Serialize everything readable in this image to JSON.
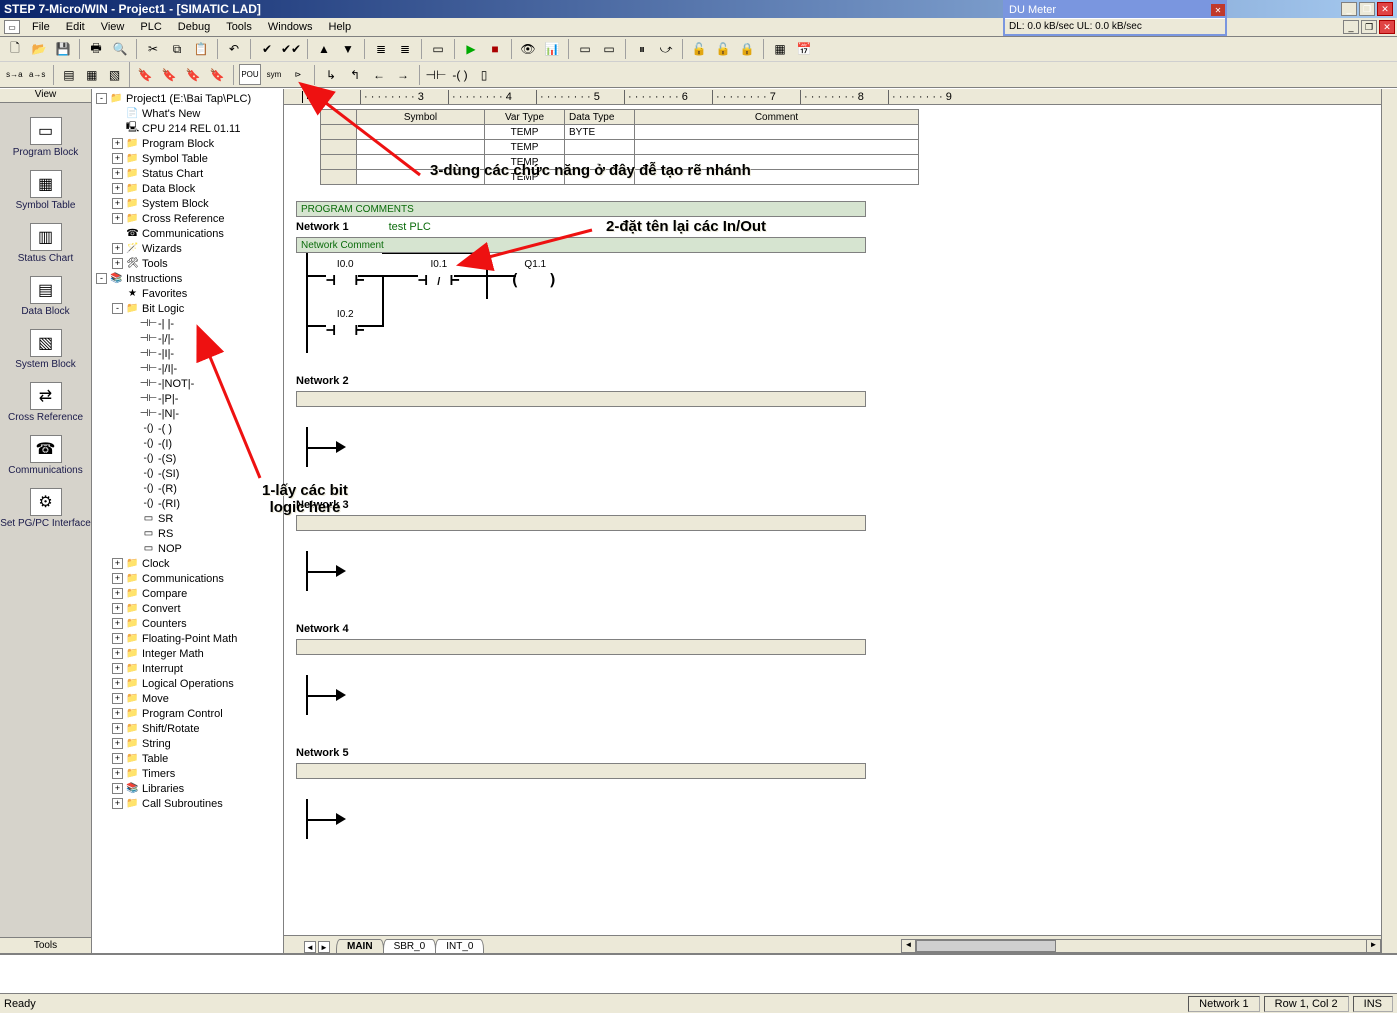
{
  "window": {
    "title": "STEP 7-Micro/WIN - Project1 - [SIMATIC LAD]"
  },
  "overlay": {
    "title": "DU Meter",
    "stats": "DL: 0.0 kB/sec   UL: 0.0 kB/sec"
  },
  "menus": [
    "File",
    "Edit",
    "View",
    "PLC",
    "Debug",
    "Tools",
    "Windows",
    "Help"
  ],
  "navpanel": {
    "header": "View",
    "items": [
      {
        "label": "Program Block",
        "icon": "▭"
      },
      {
        "label": "Symbol Table",
        "icon": "▦"
      },
      {
        "label": "Status Chart",
        "icon": "▥"
      },
      {
        "label": "Data Block",
        "icon": "▤"
      },
      {
        "label": "System Block",
        "icon": "▧"
      },
      {
        "label": "Cross Reference",
        "icon": "⇄"
      },
      {
        "label": "Communications",
        "icon": "☎"
      },
      {
        "label": "Set PG/PC Interface",
        "icon": "⚙"
      }
    ],
    "footer": "Tools"
  },
  "tree": [
    {
      "lvl": 0,
      "exp": "-",
      "icon": "📁",
      "label": "Project1 (E:\\Bai Tap\\PLC)"
    },
    {
      "lvl": 1,
      "exp": "",
      "icon": "📄",
      "label": "What's New"
    },
    {
      "lvl": 1,
      "exp": "",
      "icon": "🖳",
      "label": "CPU 214 REL 01.11"
    },
    {
      "lvl": 1,
      "exp": "+",
      "icon": "📁",
      "label": "Program Block"
    },
    {
      "lvl": 1,
      "exp": "+",
      "icon": "📁",
      "label": "Symbol Table"
    },
    {
      "lvl": 1,
      "exp": "+",
      "icon": "📁",
      "label": "Status Chart"
    },
    {
      "lvl": 1,
      "exp": "+",
      "icon": "📁",
      "label": "Data Block"
    },
    {
      "lvl": 1,
      "exp": "+",
      "icon": "📁",
      "label": "System Block"
    },
    {
      "lvl": 1,
      "exp": "+",
      "icon": "📁",
      "label": "Cross Reference"
    },
    {
      "lvl": 1,
      "exp": "",
      "icon": "☎",
      "label": "Communications"
    },
    {
      "lvl": 1,
      "exp": "+",
      "icon": "🪄",
      "label": "Wizards"
    },
    {
      "lvl": 1,
      "exp": "+",
      "icon": "🛠",
      "label": "Tools"
    },
    {
      "lvl": 0,
      "exp": "-",
      "icon": "📚",
      "label": "Instructions"
    },
    {
      "lvl": 1,
      "exp": "",
      "icon": "★",
      "label": "Favorites"
    },
    {
      "lvl": 1,
      "exp": "-",
      "icon": "📁",
      "label": "Bit Logic"
    },
    {
      "lvl": 2,
      "exp": "",
      "icon": "⊣⊢",
      "label": "-| |-"
    },
    {
      "lvl": 2,
      "exp": "",
      "icon": "⊣⊢",
      "label": "-|/|-"
    },
    {
      "lvl": 2,
      "exp": "",
      "icon": "⊣⊢",
      "label": "-|I|-"
    },
    {
      "lvl": 2,
      "exp": "",
      "icon": "⊣⊢",
      "label": "-|/I|-"
    },
    {
      "lvl": 2,
      "exp": "",
      "icon": "⊣⊢",
      "label": "-|NOT|-"
    },
    {
      "lvl": 2,
      "exp": "",
      "icon": "⊣⊢",
      "label": "-|P|-"
    },
    {
      "lvl": 2,
      "exp": "",
      "icon": "⊣⊢",
      "label": "-|N|-"
    },
    {
      "lvl": 2,
      "exp": "",
      "icon": "-()",
      "label": "-( )"
    },
    {
      "lvl": 2,
      "exp": "",
      "icon": "-()",
      "label": "-(I)"
    },
    {
      "lvl": 2,
      "exp": "",
      "icon": "-()",
      "label": "-(S)"
    },
    {
      "lvl": 2,
      "exp": "",
      "icon": "-()",
      "label": "-(SI)"
    },
    {
      "lvl": 2,
      "exp": "",
      "icon": "-()",
      "label": "-(R)"
    },
    {
      "lvl": 2,
      "exp": "",
      "icon": "-()",
      "label": "-(RI)"
    },
    {
      "lvl": 2,
      "exp": "",
      "icon": "▭",
      "label": "SR"
    },
    {
      "lvl": 2,
      "exp": "",
      "icon": "▭",
      "label": "RS"
    },
    {
      "lvl": 2,
      "exp": "",
      "icon": "▭",
      "label": "NOP"
    },
    {
      "lvl": 1,
      "exp": "+",
      "icon": "📁",
      "label": "Clock"
    },
    {
      "lvl": 1,
      "exp": "+",
      "icon": "📁",
      "label": "Communications"
    },
    {
      "lvl": 1,
      "exp": "+",
      "icon": "📁",
      "label": "Compare"
    },
    {
      "lvl": 1,
      "exp": "+",
      "icon": "📁",
      "label": "Convert"
    },
    {
      "lvl": 1,
      "exp": "+",
      "icon": "📁",
      "label": "Counters"
    },
    {
      "lvl": 1,
      "exp": "+",
      "icon": "📁",
      "label": "Floating-Point Math"
    },
    {
      "lvl": 1,
      "exp": "+",
      "icon": "📁",
      "label": "Integer Math"
    },
    {
      "lvl": 1,
      "exp": "+",
      "icon": "📁",
      "label": "Interrupt"
    },
    {
      "lvl": 1,
      "exp": "+",
      "icon": "📁",
      "label": "Logical Operations"
    },
    {
      "lvl": 1,
      "exp": "+",
      "icon": "📁",
      "label": "Move"
    },
    {
      "lvl": 1,
      "exp": "+",
      "icon": "📁",
      "label": "Program Control"
    },
    {
      "lvl": 1,
      "exp": "+",
      "icon": "📁",
      "label": "Shift/Rotate"
    },
    {
      "lvl": 1,
      "exp": "+",
      "icon": "📁",
      "label": "String"
    },
    {
      "lvl": 1,
      "exp": "+",
      "icon": "📁",
      "label": "Table"
    },
    {
      "lvl": 1,
      "exp": "+",
      "icon": "📁",
      "label": "Timers"
    },
    {
      "lvl": 1,
      "exp": "+",
      "icon": "📚",
      "label": "Libraries"
    },
    {
      "lvl": 1,
      "exp": "+",
      "icon": "📁",
      "label": "Call Subroutines"
    }
  ],
  "symtable": {
    "headers": [
      "Symbol",
      "Var Type",
      "Data Type",
      "Comment"
    ],
    "rows": [
      {
        "sym": "",
        "var": "TEMP",
        "dat": "BYTE",
        "cmt": ""
      },
      {
        "sym": "",
        "var": "TEMP",
        "dat": "",
        "cmt": ""
      },
      {
        "sym": "",
        "var": "TEMP",
        "dat": "",
        "cmt": ""
      },
      {
        "sym": "",
        "var": "TEMP",
        "dat": "",
        "cmt": ""
      }
    ]
  },
  "ruler": [
    "3",
    "4",
    "5",
    "6",
    "7",
    "8",
    "9"
  ],
  "program": {
    "pcomment": "PROGRAM COMMENTS",
    "net1": {
      "name": "Network 1",
      "title": "test PLC",
      "comment": "Network Comment",
      "io": {
        "i00": "I0.0",
        "i01": "I0.1",
        "i02": "I0.2",
        "q11": "Q1.1",
        "slash": "/"
      }
    },
    "net2": {
      "name": "Network 2"
    },
    "net3": {
      "name": "Network 3"
    },
    "net4": {
      "name": "Network 4"
    },
    "net5": {
      "name": "Network 5"
    }
  },
  "tabs": {
    "main": "MAIN",
    "sbr": "SBR_0",
    "int": "INT_0"
  },
  "status": {
    "ready": "Ready",
    "net": "Network 1",
    "pos": "Row 1, Col 2",
    "ins": "INS"
  },
  "annotations": {
    "a1": "1-lấy các bit logic here",
    "a2": "2-đặt tên lại các In/Out",
    "a3": "3-dùng các chức năng ở đây đễ tạo rẽ nhánh"
  }
}
